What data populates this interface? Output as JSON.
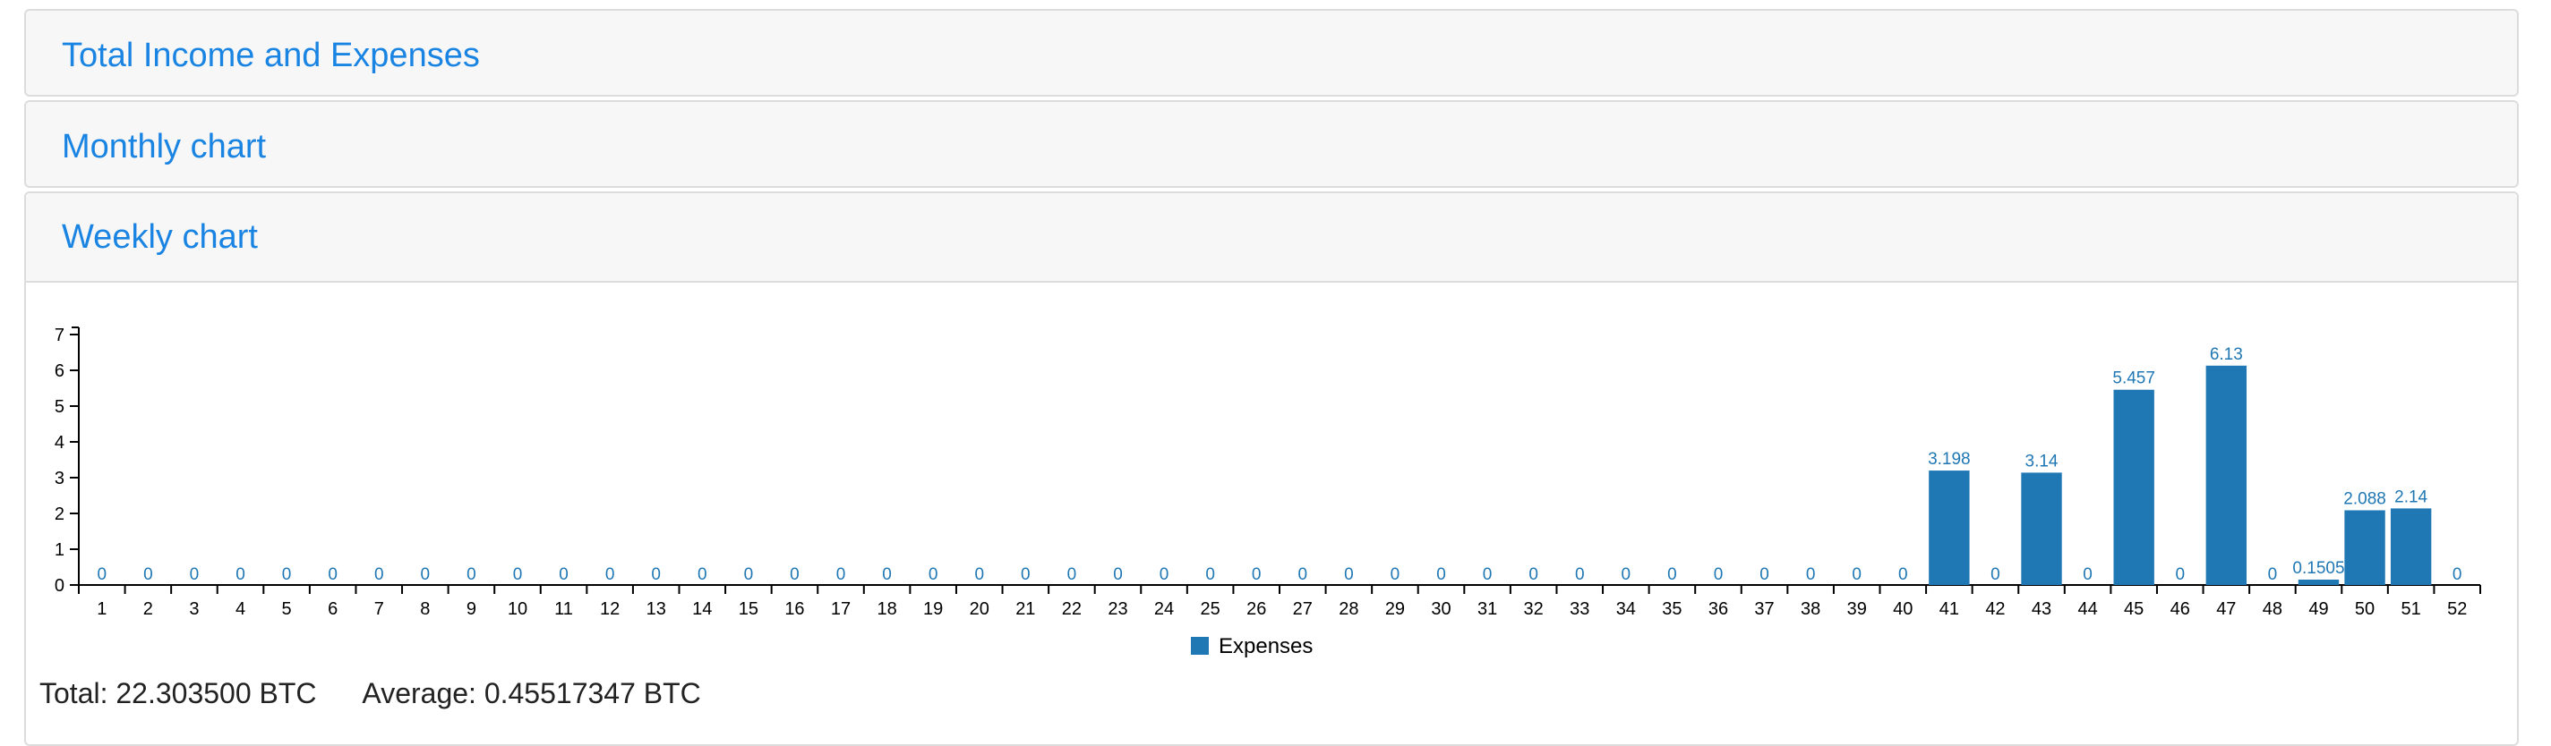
{
  "panels": {
    "total_title": "Total Income and Expenses",
    "monthly_title": "Monthly chart",
    "weekly_title": "Weekly chart"
  },
  "summary": {
    "total_text": "Total: 22.303500 BTC",
    "average_text": "Average: 0.45517347 BTC"
  },
  "colors": {
    "bar": "#1f77b4",
    "title": "#1a84e3"
  },
  "chart_data": {
    "type": "bar",
    "title": "",
    "xlabel": "",
    "ylabel": "",
    "ylim": [
      0,
      7.2
    ],
    "yticks": [
      "0",
      "1",
      "2",
      "3",
      "4",
      "5",
      "6",
      "7"
    ],
    "categories": [
      "1",
      "2",
      "3",
      "4",
      "5",
      "6",
      "7",
      "8",
      "9",
      "10",
      "11",
      "12",
      "13",
      "14",
      "15",
      "16",
      "17",
      "18",
      "19",
      "20",
      "21",
      "22",
      "23",
      "24",
      "25",
      "26",
      "27",
      "28",
      "29",
      "30",
      "31",
      "32",
      "33",
      "34",
      "35",
      "36",
      "37",
      "38",
      "39",
      "40",
      "41",
      "42",
      "43",
      "44",
      "45",
      "46",
      "47",
      "48",
      "49",
      "50",
      "51",
      "52"
    ],
    "series": [
      {
        "name": "Expenses",
        "values": [
          0,
          0,
          0,
          0,
          0,
          0,
          0,
          0,
          0,
          0,
          0,
          0,
          0,
          0,
          0,
          0,
          0,
          0,
          0,
          0,
          0,
          0,
          0,
          0,
          0,
          0,
          0,
          0,
          0,
          0,
          0,
          0,
          0,
          0,
          0,
          0,
          0,
          0,
          0,
          0,
          3.198,
          0,
          3.14,
          0,
          5.457,
          0,
          6.13,
          0,
          0.1505,
          2.088,
          2.14,
          0
        ]
      }
    ],
    "legend": "bottom-center",
    "grid": false
  }
}
